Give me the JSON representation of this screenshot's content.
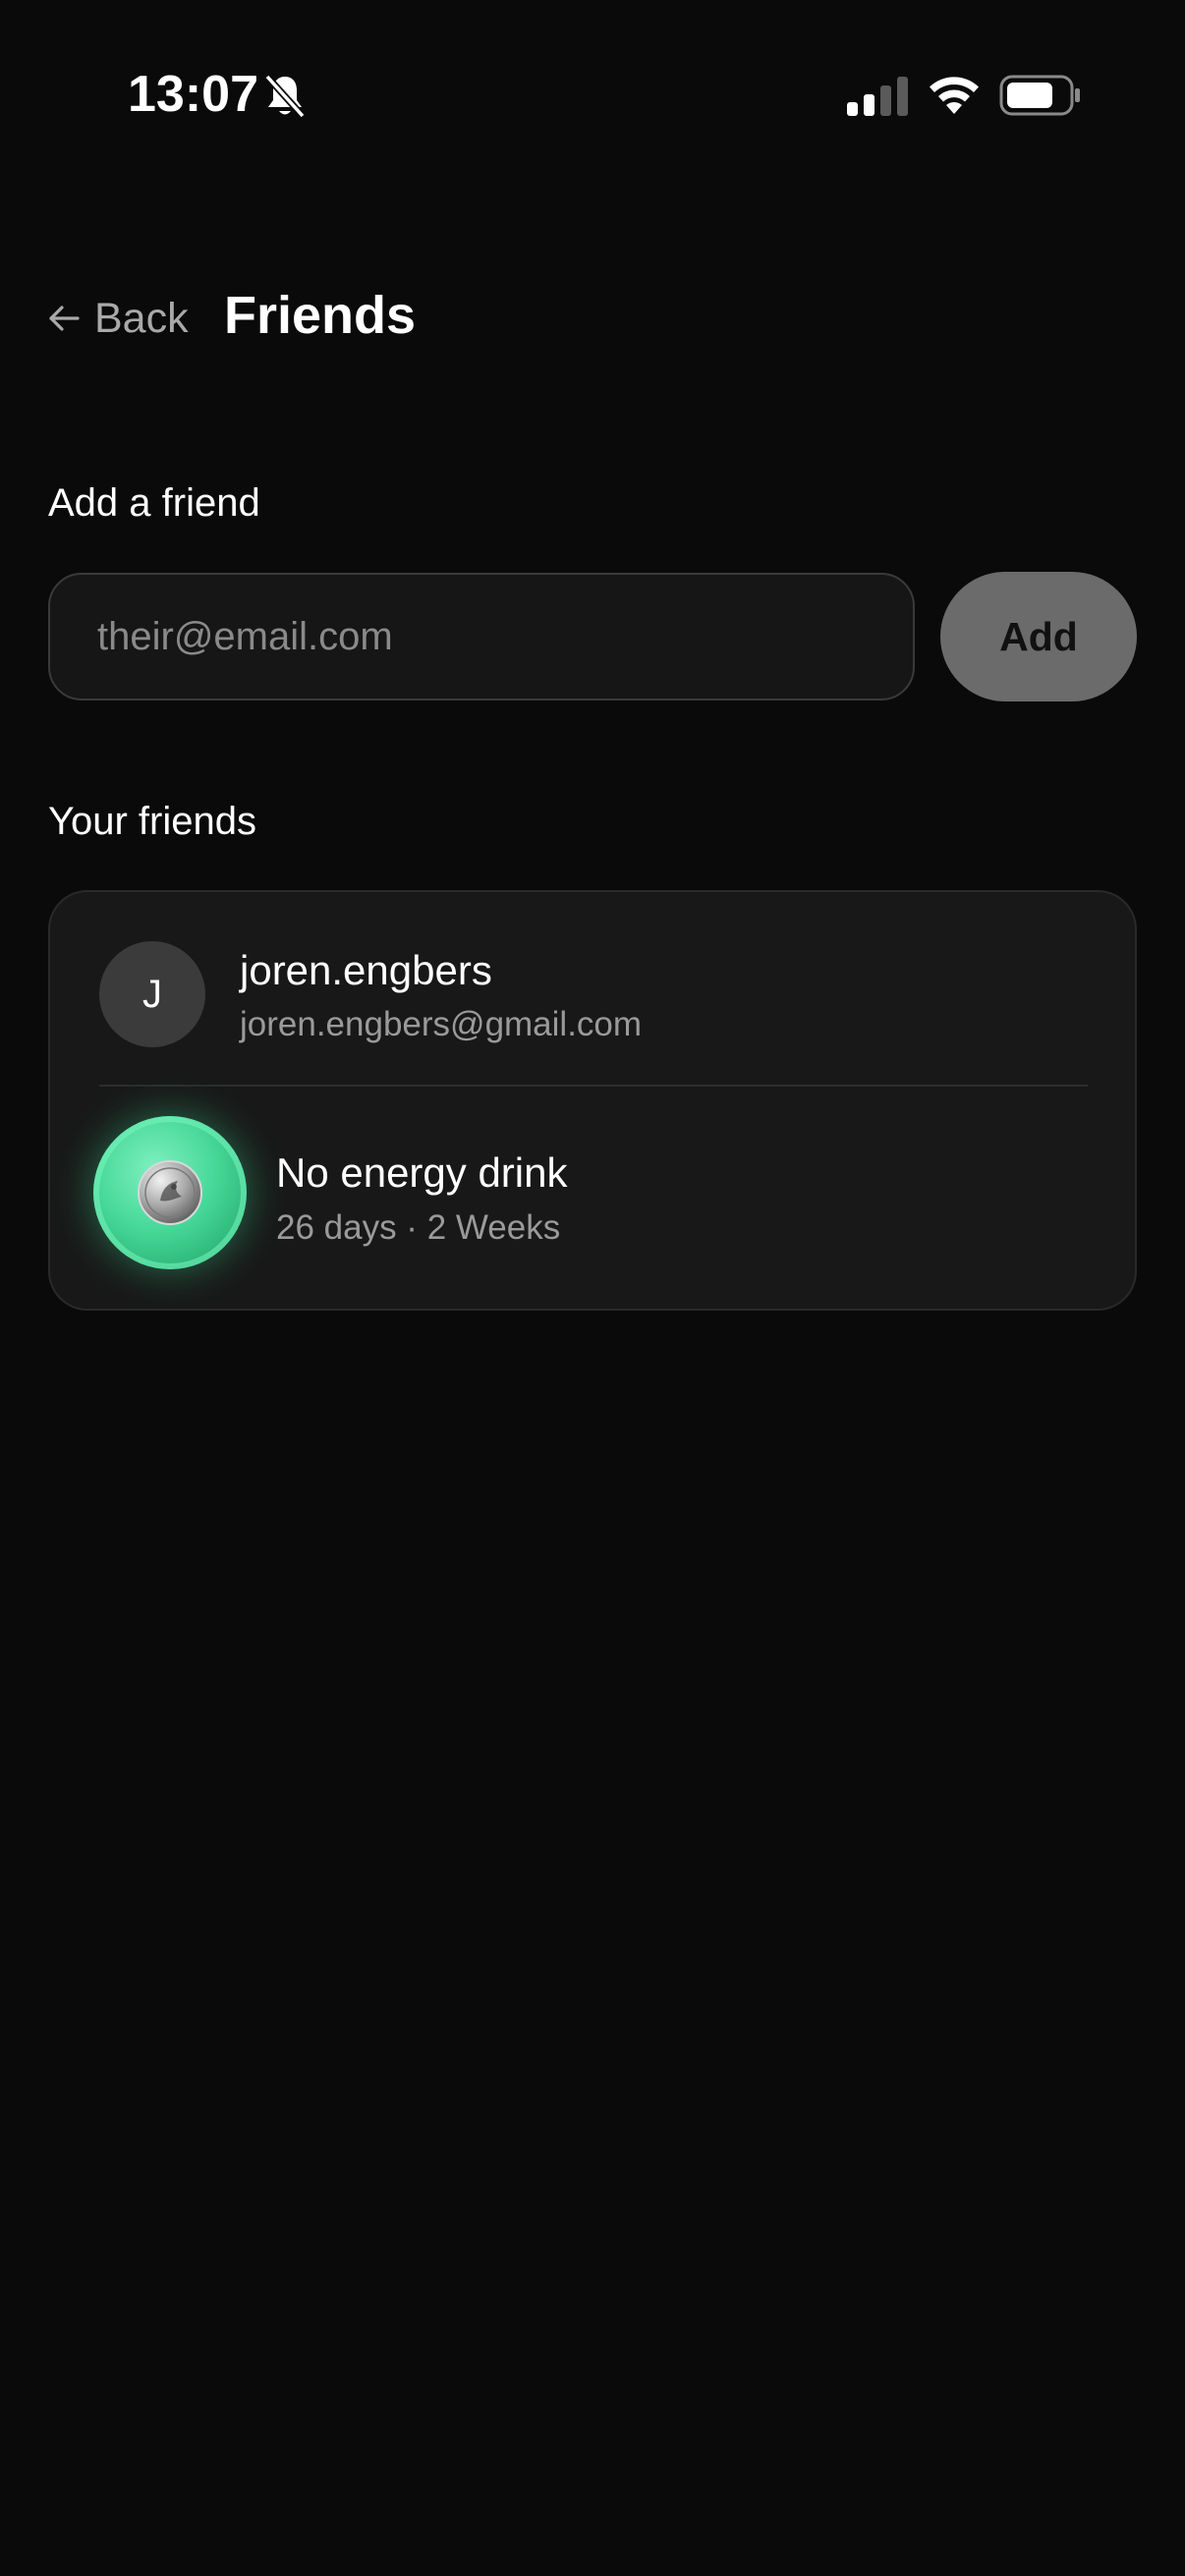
{
  "status_bar": {
    "time": "13:07",
    "icons": [
      "bell-slash-icon",
      "signal-icon",
      "wifi-icon",
      "battery-icon"
    ]
  },
  "header": {
    "back_label": "Back",
    "title": "Friends"
  },
  "add_friend": {
    "section_label": "Add a friend",
    "email_value": "",
    "email_placeholder": "their@email.com",
    "add_label": "Add"
  },
  "friends": {
    "section_label": "Your friends",
    "items": [
      {
        "initial": "J",
        "name": "joren.engbers",
        "email": "joren.engbers@gmail.com"
      }
    ],
    "goal": {
      "title": "No energy drink",
      "meta": "26 days · 2 Weeks",
      "icon": "coin-icon"
    }
  },
  "colors": {
    "background": "#0a0a0a",
    "card": "#181818",
    "accent_green": "#46d898",
    "muted_text": "#9a9a9a",
    "button_disabled": "#6b6b6b"
  }
}
